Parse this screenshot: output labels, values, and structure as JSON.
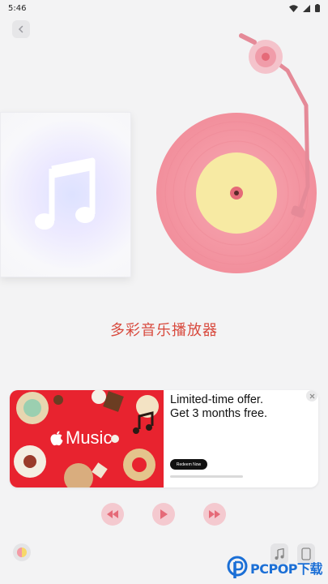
{
  "status_bar": {
    "time": "5:46",
    "icons": [
      "wifi-icon",
      "signal-icon",
      "battery-icon"
    ]
  },
  "nav": {
    "back_icon": "chevron-left-icon"
  },
  "player": {
    "album_icon": "music-note-icon",
    "title": "多彩音乐播放器",
    "colors": {
      "accent": "#d84a3e",
      "vinyl": "#f59aa6",
      "label": "#f7eaa3",
      "control_bg": "#f4c9cf",
      "control_icon": "#e56a78"
    }
  },
  "ad": {
    "brand": "Music",
    "headline_line1": "Limited-time offer.",
    "headline_line2": "Get 3 months free.",
    "cta": "Redeem Now",
    "close_icon": "close-icon"
  },
  "controls": {
    "previous_icon": "rewind-icon",
    "play_icon": "play-icon",
    "next_icon": "fast-forward-icon"
  },
  "bottom": {
    "theme_icon": "color-palette-icon",
    "music_icon": "music-note-icon",
    "screen_icon": "screen-icon"
  },
  "watermark": {
    "text": "PCPOP下载"
  }
}
